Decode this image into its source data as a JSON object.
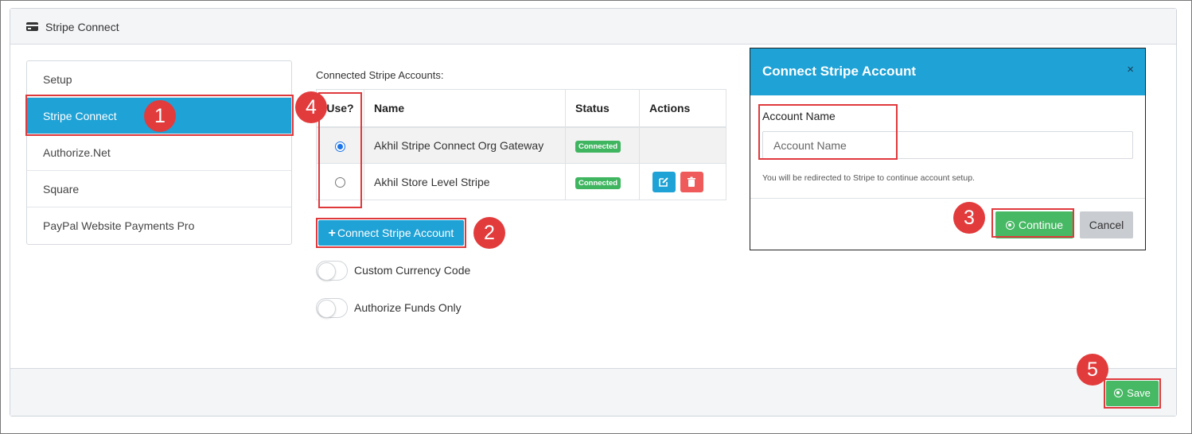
{
  "panel": {
    "title": "Stripe Connect",
    "icon": "credit-card-icon"
  },
  "sidebar": {
    "items": [
      {
        "label": "Setup",
        "active": false
      },
      {
        "label": "Stripe Connect",
        "active": true
      },
      {
        "label": "Authorize.Net",
        "active": false
      },
      {
        "label": "Square",
        "active": false
      },
      {
        "label": "PayPal Website Payments Pro",
        "active": false
      }
    ]
  },
  "accounts": {
    "section_label": "Connected Stripe Accounts:",
    "columns": [
      "Use?",
      "Name",
      "Status",
      "Actions"
    ],
    "rows": [
      {
        "selected": true,
        "name": "Akhil Stripe Connect Org Gateway",
        "status": "Connected",
        "actions": []
      },
      {
        "selected": false,
        "name": "Akhil Store Level Stripe",
        "status": "Connected",
        "actions": [
          "edit-icon",
          "trash-icon"
        ]
      }
    ]
  },
  "connect_button": {
    "label": "Connect Stripe Account",
    "icon": "plus-icon"
  },
  "toggles": [
    {
      "label": "Custom Currency Code",
      "on": false
    },
    {
      "label": "Authorize Funds Only",
      "on": false
    }
  ],
  "modal": {
    "title": "Connect Stripe Account",
    "close": "×",
    "field_label": "Account Name",
    "field_placeholder": "Account Name",
    "field_value": "",
    "help_text": "You will be redirected to Stripe to continue account setup.",
    "continue_label": "Continue",
    "cancel_label": "Cancel"
  },
  "save_button": {
    "label": "Save"
  },
  "callouts": [
    "1",
    "2",
    "3",
    "4",
    "5"
  ],
  "colors": {
    "accent": "#1fa2d6",
    "success": "#47b864",
    "danger": "#ef5b5b",
    "callout": "#e23b3c"
  }
}
